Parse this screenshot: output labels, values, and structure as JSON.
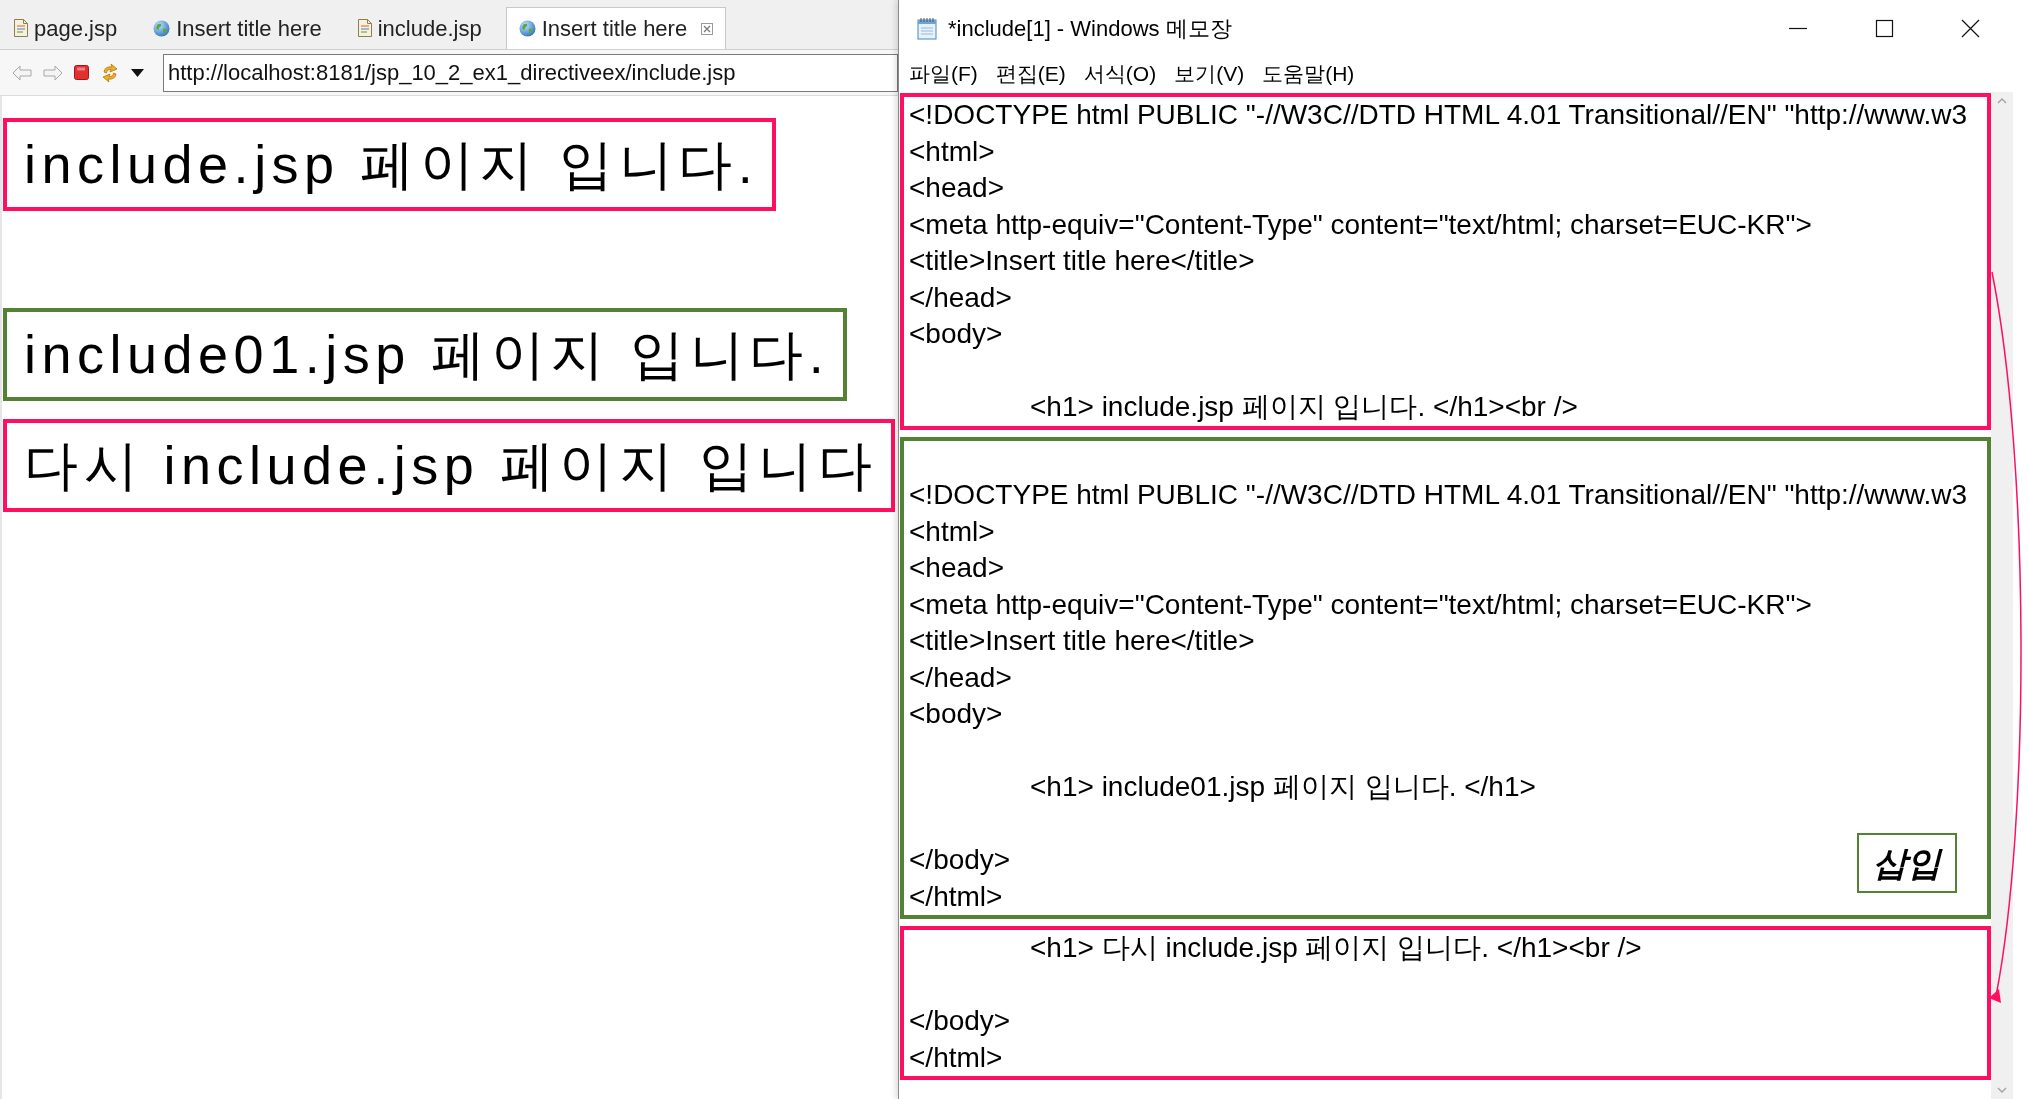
{
  "browser": {
    "tabs": [
      {
        "label": "page.jsp",
        "kind": "file",
        "selected": false
      },
      {
        "label": "Insert title here",
        "kind": "web",
        "selected": false
      },
      {
        "label": "include.jsp",
        "kind": "file",
        "selected": false
      },
      {
        "label": "Insert title here",
        "kind": "web",
        "selected": true
      }
    ],
    "url": "http://localhost:8181/jsp_10_2_ex1_directiveex/include.jsp",
    "content": [
      {
        "kind": "heading",
        "text": "include.jsp 페이지 입니다.",
        "color": "#ff0f5f"
      },
      {
        "kind": "blank"
      },
      {
        "kind": "heading",
        "text": "include01.jsp 페이지 입니다.",
        "color": "#548235"
      },
      {
        "kind": "heading",
        "text": "다시 include.jsp 페이지 입니다",
        "color": "#ff0f5f"
      }
    ]
  },
  "notepad": {
    "title": "*include[1] - Windows 메모장",
    "menu": [
      "파일(F)",
      "편집(E)",
      "서식(O)",
      "보기(V)",
      "도움말(H)"
    ],
    "sections": [
      {
        "color": "#ff0f5f",
        "lines": [
          {
            "kind": "text",
            "text": "<!DOCTYPE html PUBLIC \"-//W3C//DTD HTML 4.01 Transitional//EN\" \"http://www.w3"
          },
          {
            "kind": "text",
            "text": "<html>"
          },
          {
            "kind": "text",
            "text": "<head>"
          },
          {
            "kind": "text",
            "text": "<meta http-equiv=\"Content-Type\" content=\"text/html; charset=EUC-KR\">"
          },
          {
            "kind": "text",
            "text": "<title>Insert title here</title>"
          },
          {
            "kind": "text",
            "text": "</head>"
          },
          {
            "kind": "text",
            "text": "<body>"
          },
          {
            "kind": "blank"
          },
          {
            "kind": "text",
            "text": "\t<h1> include.jsp 페이지 입니다. </h1><br />"
          }
        ]
      },
      {
        "color": "#548235",
        "label": "삽입",
        "lines": [
          {
            "kind": "blank"
          },
          {
            "kind": "text",
            "text": "<!DOCTYPE html PUBLIC \"-//W3C//DTD HTML 4.01 Transitional//EN\" \"http://www.w3"
          },
          {
            "kind": "text",
            "text": "<html>"
          },
          {
            "kind": "text",
            "text": "<head>"
          },
          {
            "kind": "text",
            "text": "<meta http-equiv=\"Content-Type\" content=\"text/html; charset=EUC-KR\">"
          },
          {
            "kind": "text",
            "text": "<title>Insert title here</title>"
          },
          {
            "kind": "text",
            "text": "</head>"
          },
          {
            "kind": "text",
            "text": "<body>"
          },
          {
            "kind": "blank"
          },
          {
            "kind": "text",
            "text": "\t<h1> include01.jsp 페이지 입니다. </h1>"
          },
          {
            "kind": "blank"
          },
          {
            "kind": "text",
            "text": "</body>"
          },
          {
            "kind": "text",
            "text": "</html>"
          }
        ]
      },
      {
        "color": "#ff0f5f",
        "lines": [
          {
            "kind": "text",
            "text": "\t<h1> 다시 include.jsp 페이지 입니다. </h1><br />"
          },
          {
            "kind": "blank"
          },
          {
            "kind": "text",
            "text": "</body>"
          },
          {
            "kind": "text",
            "text": "</html>"
          }
        ]
      }
    ]
  }
}
